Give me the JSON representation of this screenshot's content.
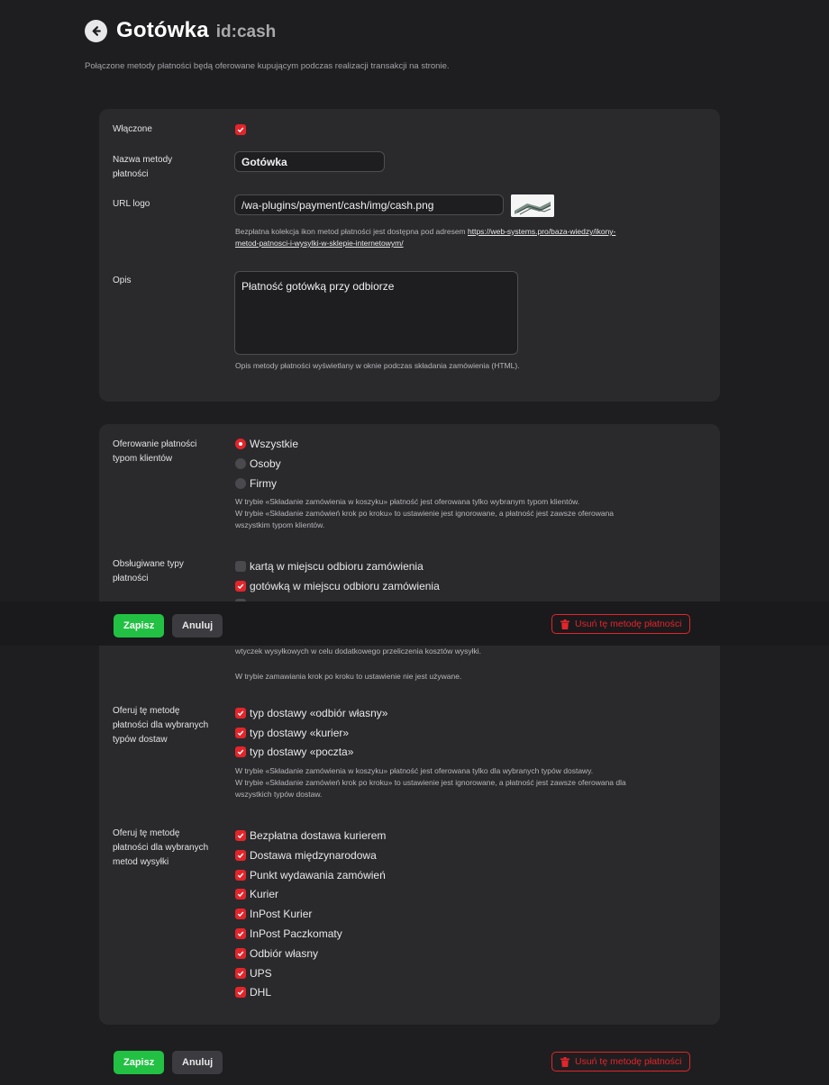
{
  "header": {
    "title": "Gotówka",
    "id_label": "id:cash",
    "subtitle": "Połączone metody płatności będą oferowane kupującym podczas realizacji transakcji na stronie."
  },
  "form": {
    "enabled_label": "Włączone",
    "enabled": true,
    "name_label_1": "Nazwa metody",
    "name_label_2": "płatności",
    "name_value": "Gotówka",
    "logo_label": "URL logo",
    "logo_value": "/wa-plugins/payment/cash/img/cash.png",
    "logo_hint_text": "Bezpłatna kolekcja ikon metod płatności jest dostępna pod adresem ",
    "logo_hint_link_1": "https://web-systems.pro/baza-wiedzy/ikony-",
    "logo_hint_link_2": "metod-patnosci-i-wysylki-w-sklepie-internetowym/",
    "desc_label": "Opis",
    "desc_value": "Płatność gotówką przy odbiorze",
    "desc_hint": "Opis metody płatności wyświetlany w oknie podczas składania zamówienia (HTML)."
  },
  "customers": {
    "label_1": "Oferowanie płatności",
    "label_2": "typom klientów",
    "options": [
      "Wszystkie",
      "Osoby",
      "Firmy"
    ],
    "selected": "Wszystkie",
    "hint_1": "W trybie «Składanie zamówienia w koszyku» płatność jest oferowana tylko wybranym typom klientów.",
    "hint_2": "W trybie «Składanie zamówień krok po kroku» to ustawienie jest ignorowane, a płatność jest zawsze oferowana",
    "hint_3": "wszystkim typom klientów."
  },
  "payment_types": {
    "label_1": "Obsługiwane typy",
    "label_2": "płatności",
    "options": [
      {
        "label": "kartą w miejscu odbioru zamówienia",
        "checked": false
      },
      {
        "label": "gotówką w miejscu odbioru zamówienia",
        "checked": true
      }
    ],
    "hint_1": "wtyczek wysyłkowych w celu dodatkowego przeliczenia kosztów wysyłki.",
    "hint_2": "W trybie zamawiania krok po kroku to ustawienie nie jest używane."
  },
  "delivery_types": {
    "label_1": "Oferuj tę metodę",
    "label_2": "płatności dla wybranych",
    "label_3": "typów dostaw",
    "options": [
      "typ dostawy «odbiór własny»",
      "typ dostawy «kurier»",
      "typ dostawy «poczta»"
    ],
    "hint_1": "W trybie «Składanie zamówienia w koszyku» płatność jest oferowana tylko dla wybranych typów dostawy.",
    "hint_2": "W trybie «Składanie zamówień krok po kroku» to ustawienie jest ignorowane, a płatność jest zawsze oferowana dla",
    "hint_3": "wszystkich typów dostaw."
  },
  "shipping_methods": {
    "label_1": "Oferuj tę metodę",
    "label_2": "płatności dla wybranych",
    "label_3": "metod wysyłki",
    "options": [
      "Bezpłatna dostawa kurierem",
      "Dostawa międzynarodowa",
      "Punkt wydawania zamówień",
      "Kurier",
      "InPost Kurier",
      "InPost Paczkomaty",
      "Odbiór własny",
      "UPS",
      "DHL"
    ]
  },
  "actions": {
    "save": "Zapisz",
    "cancel": "Anuluj",
    "delete": "Usuń tę metodę płatności"
  },
  "colors": {
    "accent_red": "#e3252b",
    "save_green": "#22c143",
    "background": "#1e1e20",
    "card": "#2a2a2d"
  }
}
